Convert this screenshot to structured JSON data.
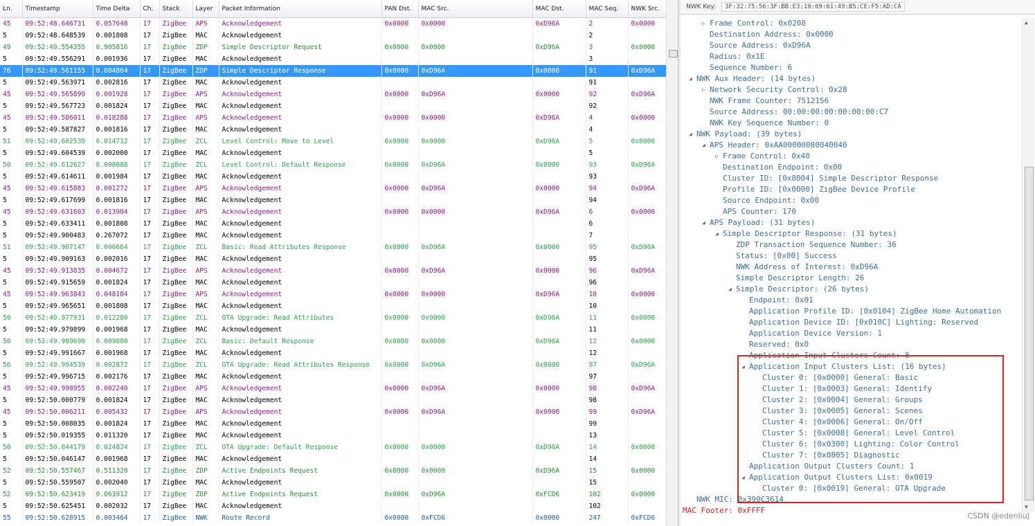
{
  "table": {
    "columns": [
      "Ln.",
      "Timestamp",
      "Time Delta",
      "Ch.",
      "Stack",
      "Layer",
      "Packet Information",
      "PAN Dst.",
      "MAC Src.",
      "MAC Dst.",
      "MAC Seq.",
      "NWK Src."
    ],
    "rows": [
      {
        "ln": "45",
        "ts": "09:52:48.646731",
        "delta": "0.057648",
        "ch": "17",
        "stack": "ZigBee",
        "layer": "APS",
        "info": "Acknowledgement",
        "pan": "0x0000",
        "macsrc": "0x0000",
        "macdst": "0xD96A",
        "seq": "2",
        "nwksrc": "0x0000",
        "color": "purple"
      },
      {
        "ln": "5",
        "ts": "09:52:48.648539",
        "delta": "0.001808",
        "ch": "17",
        "stack": "ZigBee",
        "layer": "MAC",
        "info": "Acknowledgement",
        "pan": "",
        "macsrc": "",
        "macdst": "",
        "seq": "2",
        "nwksrc": "",
        "color": "black"
      },
      {
        "ln": "49",
        "ts": "09:52:49.554355",
        "delta": "0.905816",
        "ch": "17",
        "stack": "ZigBee",
        "layer": "ZDP",
        "info": "Simple Descriptor Request",
        "pan": "0x0000",
        "macsrc": "0x0000",
        "macdst": "0xD96A",
        "seq": "3",
        "nwksrc": "0x0000",
        "color": "green"
      },
      {
        "ln": "5",
        "ts": "09:52:49.556291",
        "delta": "0.001936",
        "ch": "17",
        "stack": "ZigBee",
        "layer": "MAC",
        "info": "Acknowledgement",
        "pan": "",
        "macsrc": "",
        "macdst": "",
        "seq": "3",
        "nwksrc": "",
        "color": "black"
      },
      {
        "ln": "76",
        "ts": "09:52:49.561155",
        "delta": "0.004864",
        "ch": "17",
        "stack": "ZigBee",
        "layer": "ZDP",
        "info": "Simple Descriptor Response",
        "pan": "0x0000",
        "macsrc": "0xD96A",
        "macdst": "0x0000",
        "seq": "91",
        "nwksrc": "0xD96A",
        "color": "green",
        "selected": true
      },
      {
        "ln": "5",
        "ts": "09:52:49.563971",
        "delta": "0.002816",
        "ch": "17",
        "stack": "ZigBee",
        "layer": "MAC",
        "info": "Acknowledgement",
        "pan": "",
        "macsrc": "",
        "macdst": "",
        "seq": "91",
        "nwksrc": "",
        "color": "black"
      },
      {
        "ln": "45",
        "ts": "09:52:49.565899",
        "delta": "0.001928",
        "ch": "17",
        "stack": "ZigBee",
        "layer": "APS",
        "info": "Acknowledgement",
        "pan": "0x0000",
        "macsrc": "0xD96A",
        "macdst": "0x0000",
        "seq": "92",
        "nwksrc": "0xD96A",
        "color": "purple"
      },
      {
        "ln": "5",
        "ts": "09:52:49.567723",
        "delta": "0.001824",
        "ch": "17",
        "stack": "ZigBee",
        "layer": "MAC",
        "info": "Acknowledgement",
        "pan": "",
        "macsrc": "",
        "macdst": "",
        "seq": "92",
        "nwksrc": "",
        "color": "black"
      },
      {
        "ln": "45",
        "ts": "09:52:49.586011",
        "delta": "0.018288",
        "ch": "17",
        "stack": "ZigBee",
        "layer": "APS",
        "info": "Acknowledgement",
        "pan": "0x0000",
        "macsrc": "0x0000",
        "macdst": "0xD96A",
        "seq": "4",
        "nwksrc": "0x0000",
        "color": "purple"
      },
      {
        "ln": "5",
        "ts": "09:52:49.587827",
        "delta": "0.001816",
        "ch": "17",
        "stack": "ZigBee",
        "layer": "MAC",
        "info": "Acknowledgement",
        "pan": "",
        "macsrc": "",
        "macdst": "",
        "seq": "4",
        "nwksrc": "",
        "color": "black"
      },
      {
        "ln": "51",
        "ts": "09:52:49.602539",
        "delta": "0.014712",
        "ch": "17",
        "stack": "ZigBee",
        "layer": "ZCL",
        "info": "Level Control: Move to Level",
        "pan": "0x0000",
        "macsrc": "0x0000",
        "macdst": "0xD96A",
        "seq": "5",
        "nwksrc": "0x0000",
        "color": "teal"
      },
      {
        "ln": "5",
        "ts": "09:52:49.604539",
        "delta": "0.002000",
        "ch": "17",
        "stack": "ZigBee",
        "layer": "MAC",
        "info": "Acknowledgement",
        "pan": "",
        "macsrc": "",
        "macdst": "",
        "seq": "5",
        "nwksrc": "",
        "color": "black"
      },
      {
        "ln": "50",
        "ts": "09:52:49.612627",
        "delta": "0.008088",
        "ch": "17",
        "stack": "ZigBee",
        "layer": "ZCL",
        "info": "Level Control: Default Response",
        "pan": "0x0000",
        "macsrc": "0xD96A",
        "macdst": "0x0000",
        "seq": "93",
        "nwksrc": "0xD96A",
        "color": "teal"
      },
      {
        "ln": "5",
        "ts": "09:52:49.614611",
        "delta": "0.001984",
        "ch": "17",
        "stack": "ZigBee",
        "layer": "MAC",
        "info": "Acknowledgement",
        "pan": "",
        "macsrc": "",
        "macdst": "",
        "seq": "93",
        "nwksrc": "",
        "color": "black"
      },
      {
        "ln": "45",
        "ts": "09:52:49.615883",
        "delta": "0.001272",
        "ch": "17",
        "stack": "ZigBee",
        "layer": "APS",
        "info": "Acknowledgement",
        "pan": "0x0000",
        "macsrc": "0xD96A",
        "macdst": "0x0000",
        "seq": "94",
        "nwksrc": "0xD96A",
        "color": "purple"
      },
      {
        "ln": "5",
        "ts": "09:52:49.617699",
        "delta": "0.001816",
        "ch": "17",
        "stack": "ZigBee",
        "layer": "MAC",
        "info": "Acknowledgement",
        "pan": "",
        "macsrc": "",
        "macdst": "",
        "seq": "94",
        "nwksrc": "",
        "color": "black"
      },
      {
        "ln": "45",
        "ts": "09:52:49.631603",
        "delta": "0.013904",
        "ch": "17",
        "stack": "ZigBee",
        "layer": "APS",
        "info": "Acknowledgement",
        "pan": "0x0000",
        "macsrc": "0x0000",
        "macdst": "0xD96A",
        "seq": "6",
        "nwksrc": "0x0000",
        "color": "purple"
      },
      {
        "ln": "5",
        "ts": "09:52:49.633411",
        "delta": "0.001808",
        "ch": "17",
        "stack": "ZigBee",
        "layer": "MAC",
        "info": "Acknowledgement",
        "pan": "",
        "macsrc": "",
        "macdst": "",
        "seq": "6",
        "nwksrc": "",
        "color": "black"
      },
      {
        "ln": "5",
        "ts": "09:52:49.900483",
        "delta": "0.267072",
        "ch": "17",
        "stack": "ZigBee",
        "layer": "MAC",
        "info": "Acknowledgement",
        "pan": "",
        "macsrc": "",
        "macdst": "",
        "seq": "7",
        "nwksrc": "",
        "color": "black"
      },
      {
        "ln": "51",
        "ts": "09:52:49.907147",
        "delta": "0.006664",
        "ch": "17",
        "stack": "ZigBee",
        "layer": "ZCL",
        "info": "Basic: Read Attributes Response",
        "pan": "0x0000",
        "macsrc": "0xD96A",
        "macdst": "0x0000",
        "seq": "95",
        "nwksrc": "0xD96A",
        "color": "teal"
      },
      {
        "ln": "5",
        "ts": "09:52:49.909163",
        "delta": "0.002016",
        "ch": "17",
        "stack": "ZigBee",
        "layer": "MAC",
        "info": "Acknowledgement",
        "pan": "",
        "macsrc": "",
        "macdst": "",
        "seq": "95",
        "nwksrc": "",
        "color": "black"
      },
      {
        "ln": "45",
        "ts": "09:52:49.913835",
        "delta": "0.004672",
        "ch": "17",
        "stack": "ZigBee",
        "layer": "APS",
        "info": "Acknowledgement",
        "pan": "0x0000",
        "macsrc": "0xD96A",
        "macdst": "0x0000",
        "seq": "96",
        "nwksrc": "0xD96A",
        "color": "purple"
      },
      {
        "ln": "5",
        "ts": "09:52:49.915659",
        "delta": "0.001824",
        "ch": "17",
        "stack": "ZigBee",
        "layer": "MAC",
        "info": "Acknowledgement",
        "pan": "",
        "macsrc": "",
        "macdst": "",
        "seq": "96",
        "nwksrc": "",
        "color": "black"
      },
      {
        "ln": "45",
        "ts": "09:52:49.963843",
        "delta": "0.048184",
        "ch": "17",
        "stack": "ZigBee",
        "layer": "APS",
        "info": "Acknowledgement",
        "pan": "0x0000",
        "macsrc": "0x0000",
        "macdst": "0xD96A",
        "seq": "10",
        "nwksrc": "0x0000",
        "color": "purple"
      },
      {
        "ln": "5",
        "ts": "09:52:49.965651",
        "delta": "0.001808",
        "ch": "17",
        "stack": "ZigBee",
        "layer": "MAC",
        "info": "Acknowledgement",
        "pan": "",
        "macsrc": "",
        "macdst": "",
        "seq": "10",
        "nwksrc": "",
        "color": "black"
      },
      {
        "ln": "50",
        "ts": "09:52:49.977931",
        "delta": "0.012280",
        "ch": "17",
        "stack": "ZigBee",
        "layer": "ZCL",
        "info": "OTA Upgrade: Read Attributes",
        "pan": "0x0000",
        "macsrc": "0x0000",
        "macdst": "0xD96A",
        "seq": "11",
        "nwksrc": "0x0000",
        "color": "teal"
      },
      {
        "ln": "5",
        "ts": "09:52:49.979899",
        "delta": "0.001968",
        "ch": "17",
        "stack": "ZigBee",
        "layer": "MAC",
        "info": "Acknowledgement",
        "pan": "",
        "macsrc": "",
        "macdst": "",
        "seq": "11",
        "nwksrc": "",
        "color": "black"
      },
      {
        "ln": "50",
        "ts": "09:52:49.989699",
        "delta": "0.009800",
        "ch": "17",
        "stack": "ZigBee",
        "layer": "ZCL",
        "info": "Basic: Default Response",
        "pan": "0x0000",
        "macsrc": "0x0000",
        "macdst": "0xD96A",
        "seq": "12",
        "nwksrc": "0x0000",
        "color": "teal"
      },
      {
        "ln": "5",
        "ts": "09:52:49.991667",
        "delta": "0.001968",
        "ch": "17",
        "stack": "ZigBee",
        "layer": "MAC",
        "info": "Acknowledgement",
        "pan": "",
        "macsrc": "",
        "macdst": "",
        "seq": "12",
        "nwksrc": "",
        "color": "black"
      },
      {
        "ln": "56",
        "ts": "09:52:49.994539",
        "delta": "0.002872",
        "ch": "17",
        "stack": "ZigBee",
        "layer": "ZCL",
        "info": "OTA Upgrade: Read Attributes Response",
        "pan": "0x0000",
        "macsrc": "0xD96A",
        "macdst": "0x0000",
        "seq": "97",
        "nwksrc": "0xD96A",
        "color": "teal"
      },
      {
        "ln": "5",
        "ts": "09:52:49.996715",
        "delta": "0.002176",
        "ch": "17",
        "stack": "ZigBee",
        "layer": "MAC",
        "info": "Acknowledgement",
        "pan": "",
        "macsrc": "",
        "macdst": "",
        "seq": "97",
        "nwksrc": "",
        "color": "black"
      },
      {
        "ln": "45",
        "ts": "09:52:49.998955",
        "delta": "0.002240",
        "ch": "17",
        "stack": "ZigBee",
        "layer": "APS",
        "info": "Acknowledgement",
        "pan": "0x0000",
        "macsrc": "0xD96A",
        "macdst": "0x0000",
        "seq": "98",
        "nwksrc": "0xD96A",
        "color": "purple"
      },
      {
        "ln": "5",
        "ts": "09:52:50.000779",
        "delta": "0.001824",
        "ch": "17",
        "stack": "ZigBee",
        "layer": "MAC",
        "info": "Acknowledgement",
        "pan": "",
        "macsrc": "",
        "macdst": "",
        "seq": "98",
        "nwksrc": "",
        "color": "black"
      },
      {
        "ln": "45",
        "ts": "09:52:50.006211",
        "delta": "0.005432",
        "ch": "17",
        "stack": "ZigBee",
        "layer": "APS",
        "info": "Acknowledgement",
        "pan": "0x0000",
        "macsrc": "0xD96A",
        "macdst": "0x0000",
        "seq": "99",
        "nwksrc": "0xD96A",
        "color": "purple"
      },
      {
        "ln": "5",
        "ts": "09:52:50.008035",
        "delta": "0.001824",
        "ch": "17",
        "stack": "ZigBee",
        "layer": "MAC",
        "info": "Acknowledgement",
        "pan": "",
        "macsrc": "",
        "macdst": "",
        "seq": "99",
        "nwksrc": "",
        "color": "black"
      },
      {
        "ln": "5",
        "ts": "09:52:50.019355",
        "delta": "0.011320",
        "ch": "17",
        "stack": "ZigBee",
        "layer": "MAC",
        "info": "Acknowledgement",
        "pan": "",
        "macsrc": "",
        "macdst": "",
        "seq": "13",
        "nwksrc": "",
        "color": "black"
      },
      {
        "ln": "50",
        "ts": "09:52:50.044179",
        "delta": "0.024824",
        "ch": "17",
        "stack": "ZigBee",
        "layer": "ZCL",
        "info": "OTA Upgrade: Default Response",
        "pan": "0x0000",
        "macsrc": "0x0000",
        "macdst": "0xD96A",
        "seq": "14",
        "nwksrc": "0x0000",
        "color": "teal"
      },
      {
        "ln": "5",
        "ts": "09:52:50.046147",
        "delta": "0.001968",
        "ch": "17",
        "stack": "ZigBee",
        "layer": "MAC",
        "info": "Acknowledgement",
        "pan": "",
        "macsrc": "",
        "macdst": "",
        "seq": "14",
        "nwksrc": "",
        "color": "black"
      },
      {
        "ln": "52",
        "ts": "09:52:50.557467",
        "delta": "0.511320",
        "ch": "17",
        "stack": "ZigBee",
        "layer": "ZDP",
        "info": "Active Endpoints Request",
        "pan": "0x0000",
        "macsrc": "0x0000",
        "macdst": "0xD96A",
        "seq": "15",
        "nwksrc": "0x0000",
        "color": "green"
      },
      {
        "ln": "5",
        "ts": "09:52:50.559507",
        "delta": "0.002040",
        "ch": "17",
        "stack": "ZigBee",
        "layer": "MAC",
        "info": "Acknowledgement",
        "pan": "",
        "macsrc": "",
        "macdst": "",
        "seq": "15",
        "nwksrc": "",
        "color": "black"
      },
      {
        "ln": "52",
        "ts": "09:52:50.623419",
        "delta": "0.063912",
        "ch": "17",
        "stack": "ZigBee",
        "layer": "ZDP",
        "info": "Active Endpoints Request",
        "pan": "0x0000",
        "macsrc": "0xD96A",
        "macdst": "0xFCD6",
        "seq": "102",
        "nwksrc": "0x0000",
        "color": "green"
      },
      {
        "ln": "5",
        "ts": "09:52:50.625451",
        "delta": "0.002032",
        "ch": "17",
        "stack": "ZigBee",
        "layer": "MAC",
        "info": "Acknowledgement",
        "pan": "",
        "macsrc": "",
        "macdst": "",
        "seq": "102",
        "nwksrc": "",
        "color": "black"
      },
      {
        "ln": "55",
        "ts": "09:52:50.628915",
        "delta": "0.003464",
        "ch": "17",
        "stack": "ZigBee",
        "layer": "NWK",
        "info": "Route Record",
        "pan": "0x0000",
        "macsrc": "0xFCD6",
        "macdst": "0x0000",
        "seq": "247",
        "nwksrc": "0xFCD6",
        "color": "blue"
      }
    ]
  },
  "detail": {
    "nwk_key_label": "NWK Key:",
    "nwk_key_value": "3F:32:75:56:3F:BB:E3:10:69:61:49:B5:CE:F5:AD:CA",
    "tree": [
      {
        "text": "Frame Control: 0x0208",
        "indent": 2,
        "tw": "collapsed"
      },
      {
        "text": "Destination Address: 0x0000",
        "indent": 2
      },
      {
        "text": "Source Address: 0xD96A",
        "indent": 2
      },
      {
        "text": "Radius: 0x1E",
        "indent": 2
      },
      {
        "text": "Sequence Number: 6",
        "indent": 2
      },
      {
        "text": "NWK Aux Header: (14 bytes)",
        "indent": 1,
        "tw": "expanded"
      },
      {
        "text": "Network Security Control: 0x28",
        "indent": 2,
        "tw": "collapsed"
      },
      {
        "text": "NWK Frame Counter: 7512156",
        "indent": 2
      },
      {
        "text": "Source Address: 00:00:00:00:00:00:00:C7",
        "indent": 2
      },
      {
        "text": "NWK Key Sequence Number: 0",
        "indent": 2
      },
      {
        "text": "NWK Payload: (39 bytes)",
        "indent": 1,
        "tw": "expanded"
      },
      {
        "text": "APS Header: 0xAA00000080040040",
        "indent": 2,
        "tw": "expanded"
      },
      {
        "text": "Frame Control: 0x40",
        "indent": 3,
        "tw": "collapsed"
      },
      {
        "text": "Destination Endpoint: 0x00",
        "indent": 3
      },
      {
        "text": "Cluster ID: [0x8004] Simple Descriptor Response",
        "indent": 3
      },
      {
        "text": "Profile ID: [0x0000] ZigBee Device Profile",
        "indent": 3
      },
      {
        "text": "Source Endpoint: 0x00",
        "indent": 3
      },
      {
        "text": "APS Counter: 170",
        "indent": 3
      },
      {
        "text": "APS Payload: (31 bytes)",
        "indent": 2,
        "tw": "expanded"
      },
      {
        "text": "Simple Descriptor Response: (31 bytes)",
        "indent": 3,
        "tw": "expanded"
      },
      {
        "text": "ZDP Transaction Sequence Number: 36",
        "indent": 4
      },
      {
        "text": "Status: [0x00] Success",
        "indent": 4
      },
      {
        "text": "NWK Address of Interest: 0xD96A",
        "indent": 4
      },
      {
        "text": "Simple Descriptor Length: 26",
        "indent": 4
      },
      {
        "text": "Simple Descriptor: (26 bytes)",
        "indent": 4,
        "tw": "expanded"
      },
      {
        "text": "Endpoint: 0x01",
        "indent": 5
      },
      {
        "text": "Application Profile ID: [0x0104] ZigBee Home Automation",
        "indent": 5
      },
      {
        "text": "Application Device ID: [0x010C] Lighting: Reserved",
        "indent": 5
      },
      {
        "text": "Application Device Version: 1",
        "indent": 5
      },
      {
        "text": "Reserved: 0x0",
        "indent": 5
      },
      {
        "text": "Application Input Clusters Count: 8",
        "indent": 5
      },
      {
        "text": "Application Input Clusters List: (16 bytes)",
        "indent": 5,
        "tw": "expanded"
      },
      {
        "text": "Cluster 0: [0x0000] General: Basic",
        "indent": 6
      },
      {
        "text": "Cluster 1: [0x0003] General: Identify",
        "indent": 6
      },
      {
        "text": "Cluster 2: [0x0004] General: Groups",
        "indent": 6
      },
      {
        "text": "Cluster 3: [0x0005] General: Scenes",
        "indent": 6
      },
      {
        "text": "Cluster 4: [0x0006] General: On/Off",
        "indent": 6
      },
      {
        "text": "Cluster 5: [0x0008] General: Level Control",
        "indent": 6
      },
      {
        "text": "Cluster 6: [0x0300] Lighting: Color Control",
        "indent": 6
      },
      {
        "text": "Cluster 7: [0x0805] Diagnostic",
        "indent": 6
      },
      {
        "text": "Application Output Clusters Count: 1",
        "indent": 5
      },
      {
        "text": "Application Output Clusters List: 0x0019",
        "indent": 5,
        "tw": "expanded"
      },
      {
        "text": "Cluster 0: [0x0019] General: OTA Upgrade",
        "indent": 6
      },
      {
        "text": "NWK MIC: 0x390C3614",
        "indent": 1
      },
      {
        "text": "MAC Footer: 0xFFFF",
        "indent": 0,
        "color": "red"
      }
    ]
  },
  "watermark": "CSDN @edenliuJ",
  "colors": {
    "selected_row": "#3399ff",
    "purple": "#8b1a8b",
    "green": "#2e8b3a",
    "teal": "#2aa24a",
    "blue": "#1f5fa8",
    "tree_text": "#3c6e98",
    "highlight_box": "#e02020"
  }
}
